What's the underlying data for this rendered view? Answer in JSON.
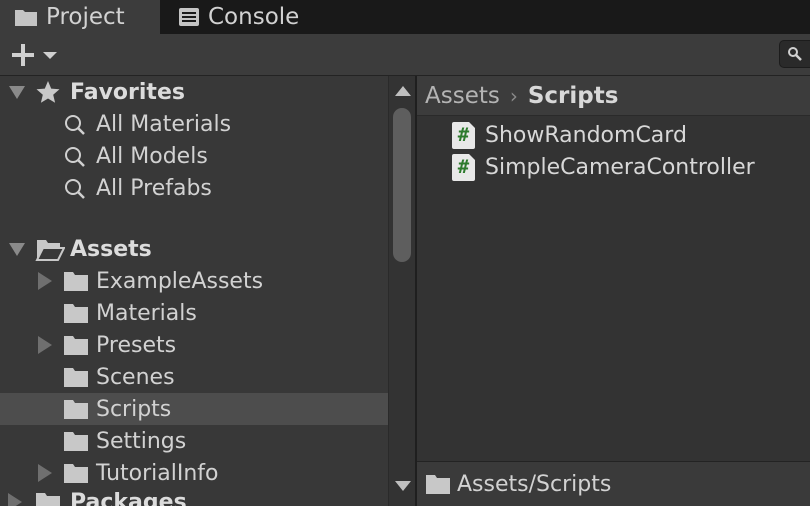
{
  "tabs": {
    "project_label": "Project",
    "console_label": "Console"
  },
  "toolbar": {
    "add_icon": "plus-icon",
    "dropdown_icon": "chevron-down-icon",
    "search_icon": "search-icon"
  },
  "favorites": {
    "label": "Favorites",
    "items": [
      "All Materials",
      "All Models",
      "All Prefabs"
    ]
  },
  "assets": {
    "label": "Assets",
    "folders": [
      {
        "label": "ExampleAssets",
        "expandable": true,
        "selected": false
      },
      {
        "label": "Materials",
        "expandable": false,
        "selected": false
      },
      {
        "label": "Presets",
        "expandable": true,
        "selected": false
      },
      {
        "label": "Scenes",
        "expandable": false,
        "selected": false
      },
      {
        "label": "Scripts",
        "expandable": false,
        "selected": true
      },
      {
        "label": "Settings",
        "expandable": false,
        "selected": false
      },
      {
        "label": "TutorialInfo",
        "expandable": true,
        "selected": false
      }
    ]
  },
  "packages": {
    "label": "Packages"
  },
  "breadcrumb": {
    "root": "Assets",
    "current": "Scripts"
  },
  "files": [
    {
      "name": "ShowRandomCard",
      "icon_glyph": "#"
    },
    {
      "name": "SimpleCameraController",
      "icon_glyph": "#"
    }
  ],
  "footer": {
    "path": "Assets/Scripts"
  },
  "colors": {
    "selection": "#4d4d4d",
    "script_icon_hash": "#2c7a2c"
  }
}
